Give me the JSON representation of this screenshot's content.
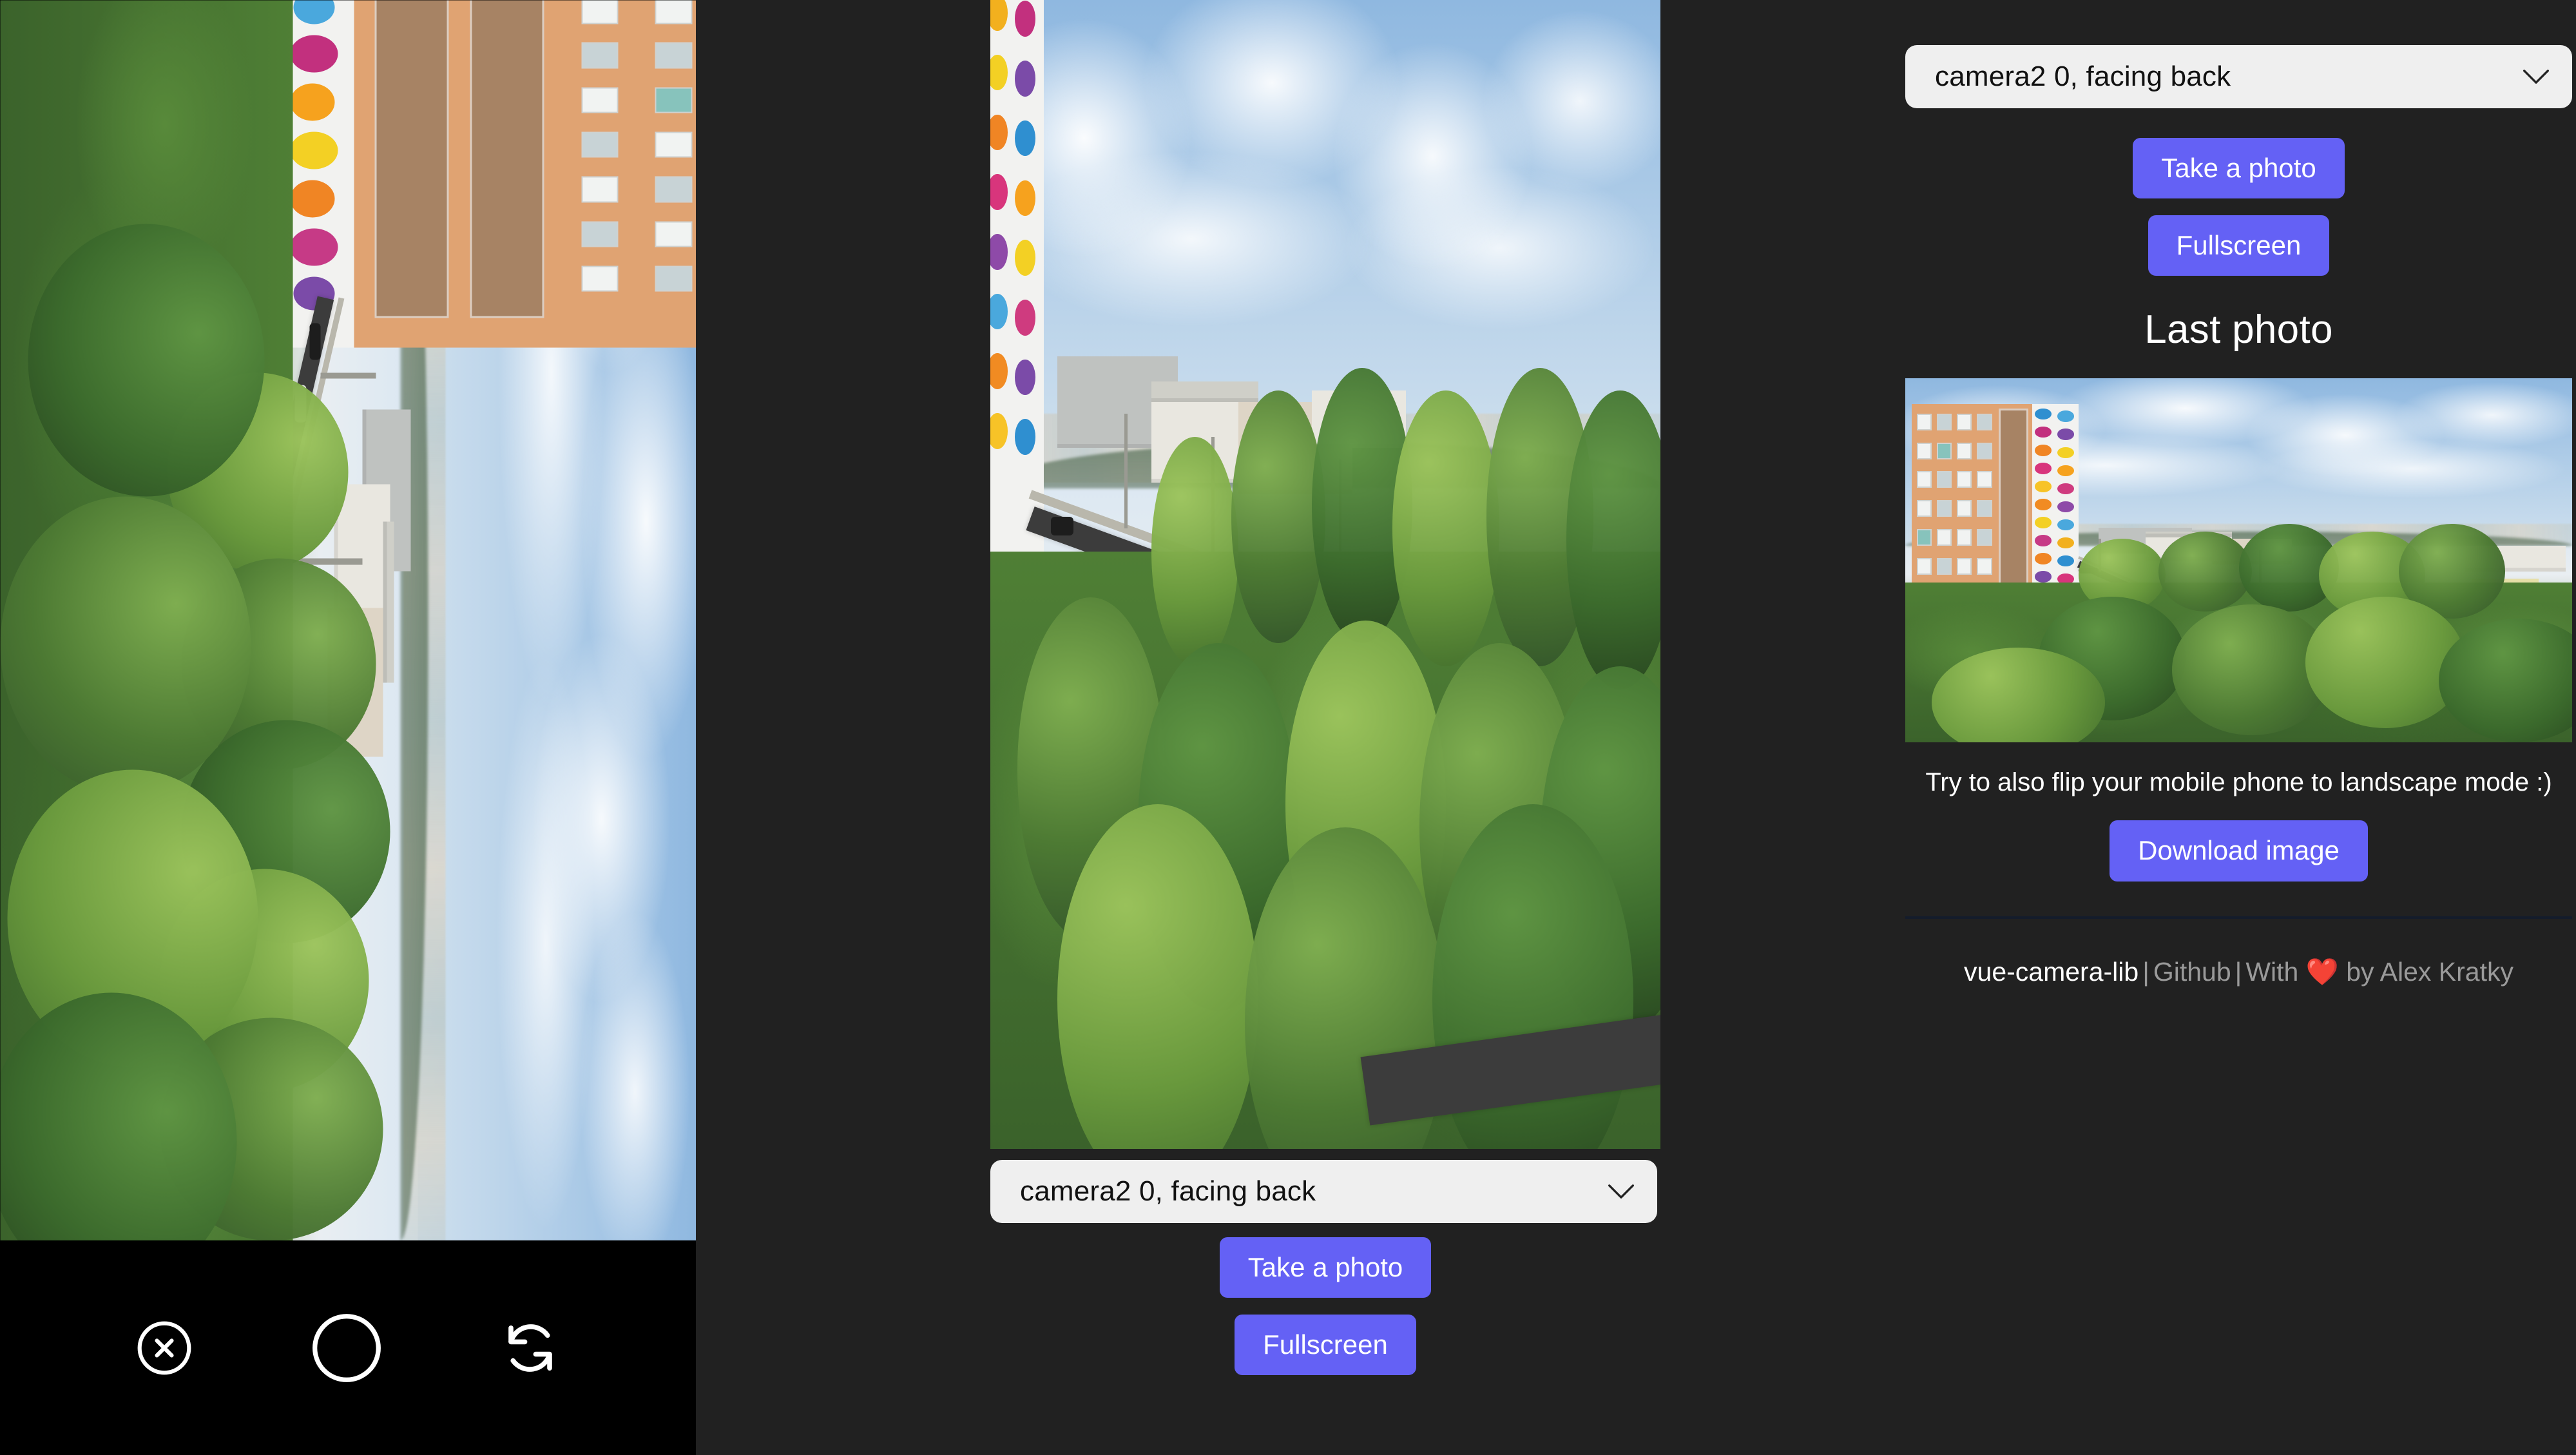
{
  "page": {
    "background_color": "#212121",
    "accent_color": "#6461f5",
    "select_background": "#efefef",
    "divider_color": "#141c2b"
  },
  "fullscreen_overlay": {
    "close_icon": "close-circle-icon",
    "shutter_icon": "shutter-circle-icon",
    "switch_camera_icon": "switch-camera-icon"
  },
  "camera_column": {
    "select": {
      "value": "camera2 0, facing back",
      "chevron_icon": "chevron-down-icon"
    },
    "take_photo_label": "Take a photo",
    "fullscreen_label": "Fullscreen"
  },
  "side_panel": {
    "select": {
      "value": "camera2 0, facing back",
      "chevron_icon": "chevron-down-icon"
    },
    "take_photo_label": "Take a photo",
    "fullscreen_label": "Fullscreen",
    "last_photo_title": "Last photo",
    "hint": "Try to also flip your mobile phone to landscape mode :)",
    "download_label": "Download image",
    "footer": {
      "lib_name": "vue-camera-lib",
      "sep1": "|",
      "github_label": "Github",
      "sep2": "|",
      "with_label": "With",
      "heart": "❤️",
      "by_label": "by Alex Kratky"
    }
  }
}
